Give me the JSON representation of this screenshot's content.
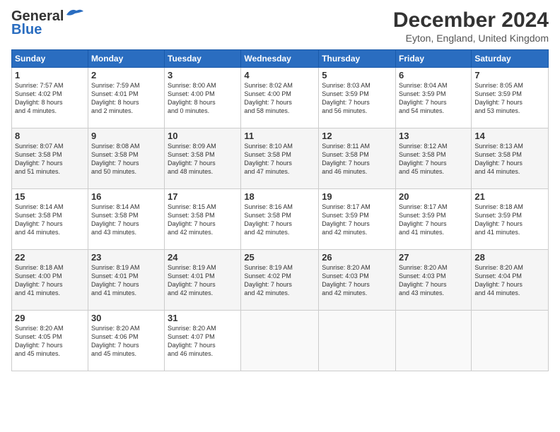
{
  "header": {
    "logo_general": "General",
    "logo_blue": "Blue",
    "title": "December 2024",
    "subtitle": "Eyton, England, United Kingdom"
  },
  "days_of_week": [
    "Sunday",
    "Monday",
    "Tuesday",
    "Wednesday",
    "Thursday",
    "Friday",
    "Saturday"
  ],
  "weeks": [
    [
      {
        "day": "1",
        "info": "Sunrise: 7:57 AM\nSunset: 4:02 PM\nDaylight: 8 hours\nand 4 minutes."
      },
      {
        "day": "2",
        "info": "Sunrise: 7:59 AM\nSunset: 4:01 PM\nDaylight: 8 hours\nand 2 minutes."
      },
      {
        "day": "3",
        "info": "Sunrise: 8:00 AM\nSunset: 4:00 PM\nDaylight: 8 hours\nand 0 minutes."
      },
      {
        "day": "4",
        "info": "Sunrise: 8:02 AM\nSunset: 4:00 PM\nDaylight: 7 hours\nand 58 minutes."
      },
      {
        "day": "5",
        "info": "Sunrise: 8:03 AM\nSunset: 3:59 PM\nDaylight: 7 hours\nand 56 minutes."
      },
      {
        "day": "6",
        "info": "Sunrise: 8:04 AM\nSunset: 3:59 PM\nDaylight: 7 hours\nand 54 minutes."
      },
      {
        "day": "7",
        "info": "Sunrise: 8:05 AM\nSunset: 3:59 PM\nDaylight: 7 hours\nand 53 minutes."
      }
    ],
    [
      {
        "day": "8",
        "info": "Sunrise: 8:07 AM\nSunset: 3:58 PM\nDaylight: 7 hours\nand 51 minutes."
      },
      {
        "day": "9",
        "info": "Sunrise: 8:08 AM\nSunset: 3:58 PM\nDaylight: 7 hours\nand 50 minutes."
      },
      {
        "day": "10",
        "info": "Sunrise: 8:09 AM\nSunset: 3:58 PM\nDaylight: 7 hours\nand 48 minutes."
      },
      {
        "day": "11",
        "info": "Sunrise: 8:10 AM\nSunset: 3:58 PM\nDaylight: 7 hours\nand 47 minutes."
      },
      {
        "day": "12",
        "info": "Sunrise: 8:11 AM\nSunset: 3:58 PM\nDaylight: 7 hours\nand 46 minutes."
      },
      {
        "day": "13",
        "info": "Sunrise: 8:12 AM\nSunset: 3:58 PM\nDaylight: 7 hours\nand 45 minutes."
      },
      {
        "day": "14",
        "info": "Sunrise: 8:13 AM\nSunset: 3:58 PM\nDaylight: 7 hours\nand 44 minutes."
      }
    ],
    [
      {
        "day": "15",
        "info": "Sunrise: 8:14 AM\nSunset: 3:58 PM\nDaylight: 7 hours\nand 44 minutes."
      },
      {
        "day": "16",
        "info": "Sunrise: 8:14 AM\nSunset: 3:58 PM\nDaylight: 7 hours\nand 43 minutes."
      },
      {
        "day": "17",
        "info": "Sunrise: 8:15 AM\nSunset: 3:58 PM\nDaylight: 7 hours\nand 42 minutes."
      },
      {
        "day": "18",
        "info": "Sunrise: 8:16 AM\nSunset: 3:58 PM\nDaylight: 7 hours\nand 42 minutes."
      },
      {
        "day": "19",
        "info": "Sunrise: 8:17 AM\nSunset: 3:59 PM\nDaylight: 7 hours\nand 42 minutes."
      },
      {
        "day": "20",
        "info": "Sunrise: 8:17 AM\nSunset: 3:59 PM\nDaylight: 7 hours\nand 41 minutes."
      },
      {
        "day": "21",
        "info": "Sunrise: 8:18 AM\nSunset: 3:59 PM\nDaylight: 7 hours\nand 41 minutes."
      }
    ],
    [
      {
        "day": "22",
        "info": "Sunrise: 8:18 AM\nSunset: 4:00 PM\nDaylight: 7 hours\nand 41 minutes."
      },
      {
        "day": "23",
        "info": "Sunrise: 8:19 AM\nSunset: 4:01 PM\nDaylight: 7 hours\nand 41 minutes."
      },
      {
        "day": "24",
        "info": "Sunrise: 8:19 AM\nSunset: 4:01 PM\nDaylight: 7 hours\nand 42 minutes."
      },
      {
        "day": "25",
        "info": "Sunrise: 8:19 AM\nSunset: 4:02 PM\nDaylight: 7 hours\nand 42 minutes."
      },
      {
        "day": "26",
        "info": "Sunrise: 8:20 AM\nSunset: 4:03 PM\nDaylight: 7 hours\nand 42 minutes."
      },
      {
        "day": "27",
        "info": "Sunrise: 8:20 AM\nSunset: 4:03 PM\nDaylight: 7 hours\nand 43 minutes."
      },
      {
        "day": "28",
        "info": "Sunrise: 8:20 AM\nSunset: 4:04 PM\nDaylight: 7 hours\nand 44 minutes."
      }
    ],
    [
      {
        "day": "29",
        "info": "Sunrise: 8:20 AM\nSunset: 4:05 PM\nDaylight: 7 hours\nand 45 minutes."
      },
      {
        "day": "30",
        "info": "Sunrise: 8:20 AM\nSunset: 4:06 PM\nDaylight: 7 hours\nand 45 minutes."
      },
      {
        "day": "31",
        "info": "Sunrise: 8:20 AM\nSunset: 4:07 PM\nDaylight: 7 hours\nand 46 minutes."
      },
      {
        "day": "",
        "info": ""
      },
      {
        "day": "",
        "info": ""
      },
      {
        "day": "",
        "info": ""
      },
      {
        "day": "",
        "info": ""
      }
    ]
  ]
}
